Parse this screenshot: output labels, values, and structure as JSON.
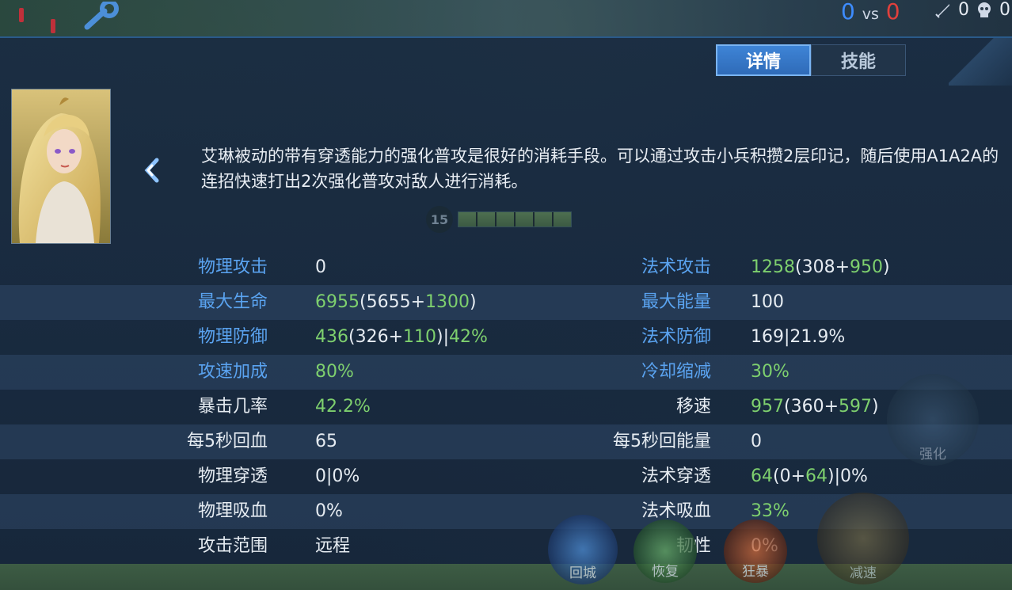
{
  "hud": {
    "score_blue": "0",
    "score_vs": "vs",
    "score_red": "0",
    "kills": "0",
    "deaths": "0"
  },
  "tabs": [
    {
      "label": "详情",
      "active": true
    },
    {
      "label": "技能",
      "active": false
    }
  ],
  "hero": {
    "tip": "艾琳被动的带有穿透能力的强化普攻是很好的消耗手段。可以通过攻击小兵积攒2层印记，随后使用A1A2A的连招快速打出2次强化普攻对敌人进行消耗。",
    "level": "15"
  },
  "stats": [
    {
      "left": {
        "label": "物理攻击",
        "label_color": "blue",
        "parts": [
          {
            "t": "0",
            "c": "v"
          }
        ]
      },
      "right": {
        "label": "法术攻击",
        "label_color": "blue",
        "parts": [
          {
            "t": "1258",
            "c": "g"
          },
          {
            "t": "(308+",
            "c": "v"
          },
          {
            "t": "950",
            "c": "g"
          },
          {
            "t": ")",
            "c": "v"
          }
        ]
      }
    },
    {
      "left": {
        "label": "最大生命",
        "label_color": "blue",
        "parts": [
          {
            "t": "6955",
            "c": "g"
          },
          {
            "t": "(5655+",
            "c": "v"
          },
          {
            "t": "1300",
            "c": "g"
          },
          {
            "t": ")",
            "c": "v"
          }
        ]
      },
      "right": {
        "label": "最大能量",
        "label_color": "blue",
        "parts": [
          {
            "t": "100",
            "c": "v"
          }
        ]
      }
    },
    {
      "left": {
        "label": "物理防御",
        "label_color": "blue",
        "parts": [
          {
            "t": "436",
            "c": "g"
          },
          {
            "t": "(326+",
            "c": "v"
          },
          {
            "t": "110",
            "c": "g"
          },
          {
            "t": ")|",
            "c": "v"
          },
          {
            "t": "42%",
            "c": "g"
          }
        ]
      },
      "right": {
        "label": "法术防御",
        "label_color": "blue",
        "parts": [
          {
            "t": "169|21.9%",
            "c": "v"
          }
        ]
      }
    },
    {
      "left": {
        "label": "攻速加成",
        "label_color": "blue",
        "parts": [
          {
            "t": "80%",
            "c": "g"
          }
        ]
      },
      "right": {
        "label": "冷却缩减",
        "label_color": "blue",
        "parts": [
          {
            "t": "30%",
            "c": "g"
          }
        ]
      }
    },
    {
      "left": {
        "label": "暴击几率",
        "label_color": "white",
        "parts": [
          {
            "t": "42.2%",
            "c": "g"
          }
        ]
      },
      "right": {
        "label": "移速",
        "label_color": "white",
        "parts": [
          {
            "t": "957",
            "c": "g"
          },
          {
            "t": "(360+",
            "c": "v"
          },
          {
            "t": "597",
            "c": "g"
          },
          {
            "t": ")",
            "c": "v"
          }
        ]
      }
    },
    {
      "left": {
        "label": "每5秒回血",
        "label_color": "white",
        "parts": [
          {
            "t": "65",
            "c": "v"
          }
        ]
      },
      "right": {
        "label": "每5秒回能量",
        "label_color": "white",
        "parts": [
          {
            "t": "0",
            "c": "v"
          }
        ]
      }
    },
    {
      "left": {
        "label": "物理穿透",
        "label_color": "white",
        "parts": [
          {
            "t": "0|0%",
            "c": "v"
          }
        ]
      },
      "right": {
        "label": "法术穿透",
        "label_color": "white",
        "parts": [
          {
            "t": "64",
            "c": "g"
          },
          {
            "t": "(0+",
            "c": "v"
          },
          {
            "t": "64",
            "c": "g"
          },
          {
            "t": ")|0%",
            "c": "v"
          }
        ]
      }
    },
    {
      "left": {
        "label": "物理吸血",
        "label_color": "white",
        "parts": [
          {
            "t": "0%",
            "c": "v"
          }
        ]
      },
      "right": {
        "label": "法术吸血",
        "label_color": "white",
        "parts": [
          {
            "t": "33%",
            "c": "g"
          }
        ]
      }
    },
    {
      "left": {
        "label": "攻击范围",
        "label_color": "white",
        "parts": [
          {
            "t": "远程",
            "c": "v"
          }
        ]
      },
      "right": {
        "label": "韧性",
        "label_color": "white",
        "parts": [
          {
            "t": "0%",
            "c": "v"
          }
        ]
      }
    }
  ],
  "skill_buttons": [
    {
      "label": "回城"
    },
    {
      "label": "恢复"
    },
    {
      "label": "狂暴"
    },
    {
      "label": "减速"
    },
    {
      "label": "强化"
    }
  ],
  "colors": {
    "label_blue": "#5aa3f0",
    "value_green": "#7ed06e",
    "value_white": "#e6ecf2",
    "tab_active": "#3e84d6"
  }
}
